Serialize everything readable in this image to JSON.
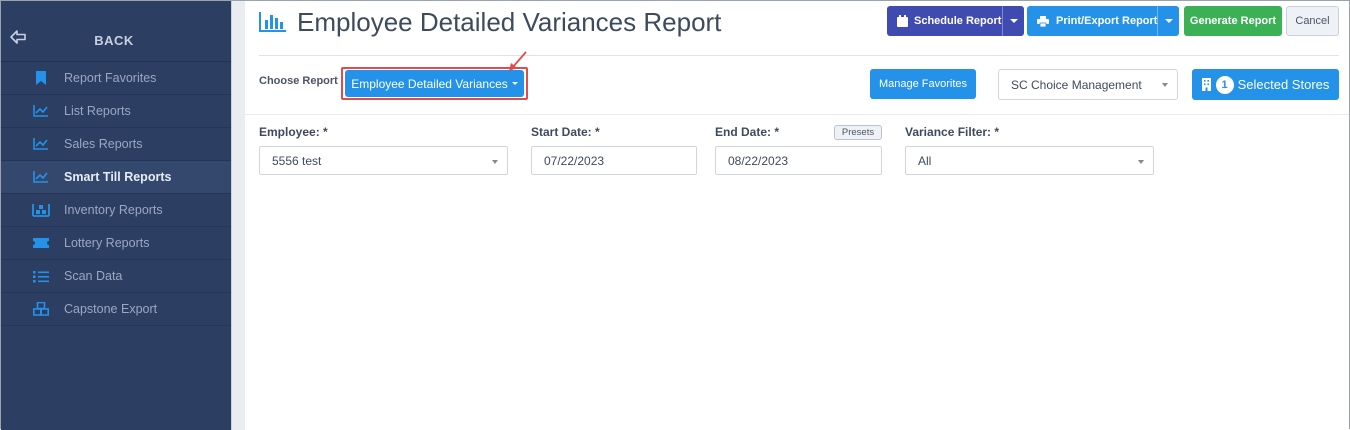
{
  "sidebar": {
    "back_label": "BACK",
    "items": [
      {
        "label": "Report Favorites",
        "icon": "bookmark-icon"
      },
      {
        "label": "List Reports",
        "icon": "line-chart-icon"
      },
      {
        "label": "Sales Reports",
        "icon": "line-chart-icon"
      },
      {
        "label": "Smart Till Reports",
        "icon": "line-chart-icon",
        "active": true
      },
      {
        "label": "Inventory Reports",
        "icon": "warehouse-icon"
      },
      {
        "label": "Lottery Reports",
        "icon": "ticket-icon"
      },
      {
        "label": "Scan Data",
        "icon": "list-icon"
      },
      {
        "label": "Capstone Export",
        "icon": "cubes-icon"
      }
    ]
  },
  "header": {
    "title": "Employee Detailed Variances Report",
    "schedule_label": "Schedule Report",
    "print_label": "Print/Export Report",
    "generate_label": "Generate Report",
    "cancel_label": "Cancel"
  },
  "report_bar": {
    "choose_label": "Choose Report",
    "report_selected": "Employee Detailed Variances",
    "manage_favorites_label": "Manage Favorites",
    "store_group": "SC Choice Management",
    "selected_count": "1",
    "selected_stores_label": "Selected Stores"
  },
  "filters": {
    "employee_label": "Employee: *",
    "employee_value": "5556 test",
    "start_label": "Start Date: *",
    "start_value": "07/22/2023",
    "end_label": "End Date: *",
    "end_value": "08/22/2023",
    "presets_label": "Presets",
    "variance_label": "Variance Filter: *",
    "variance_value": "All"
  },
  "colors": {
    "sidebar_bg": "#2c3e62",
    "primary": "#2392e8",
    "schedule": "#3f4bb0",
    "generate": "#3cb054",
    "highlight": "#e14b4b"
  }
}
